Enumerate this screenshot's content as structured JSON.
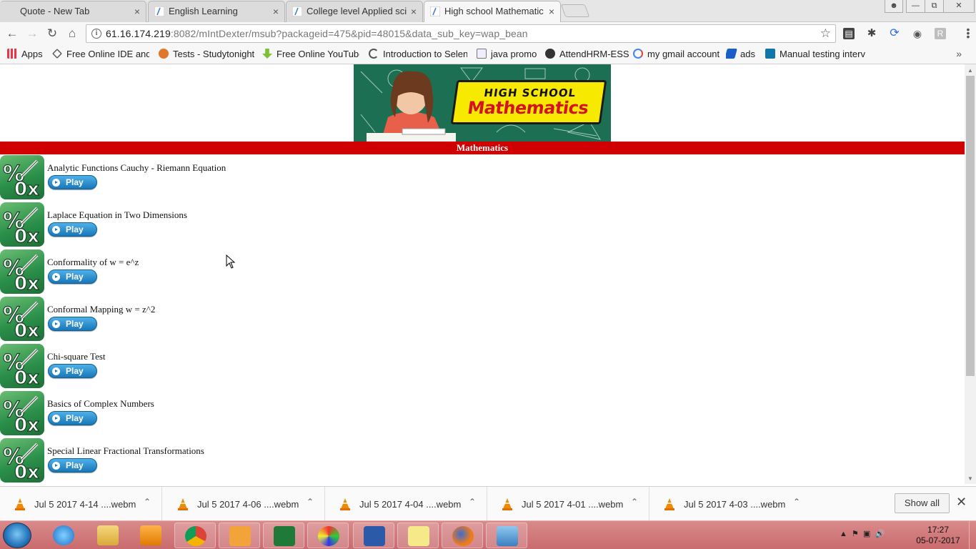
{
  "browser": {
    "tabs": [
      {
        "label": "Quote - New Tab",
        "active": false
      },
      {
        "label": "English Learning",
        "active": false
      },
      {
        "label": "College level Applied sci",
        "active": false
      },
      {
        "label": "High school Mathematic",
        "active": true
      }
    ],
    "close_glyph": "×",
    "url_host": "61.16.174.219",
    "url_rest": ":8082/mIntDexter/msub?packageid=475&pid=48015&data_sub_key=wap_bean",
    "bookmarks": [
      {
        "label": "Apps",
        "icon": "apps-grid-icon"
      },
      {
        "label": "Free Online IDE and T",
        "icon": "ide-icon"
      },
      {
        "label": "Tests - Studytonight",
        "icon": "studytonight-icon"
      },
      {
        "label": "Free Online YouTube",
        "icon": "download-arrow-icon"
      },
      {
        "label": "Introduction to Selen",
        "icon": "selenium-icon"
      },
      {
        "label": "java promo",
        "icon": "page-icon"
      },
      {
        "label": "AttendHRM-ESS",
        "icon": "gear-icon"
      },
      {
        "label": "my gmail account",
        "icon": "google-icon"
      },
      {
        "label": "ads",
        "icon": "ads-icon"
      },
      {
        "label": "Manual testing interv",
        "icon": "linkedin-icon"
      }
    ],
    "profile_initial": "R"
  },
  "page": {
    "banner": {
      "line1": "HIGH SCHOOL",
      "line2": "Mathematics"
    },
    "section_title": "Mathematics",
    "play_label": "Play",
    "items": [
      {
        "title": "Analytic Functions Cauchy - Riemann Equation"
      },
      {
        "title": "Laplace Equation in Two Dimensions"
      },
      {
        "title": "Conformality of w = e^z"
      },
      {
        "title": "Conformal Mapping w = z^2"
      },
      {
        "title": "Chi-square Test"
      },
      {
        "title": "Basics of Complex Numbers"
      },
      {
        "title": "Special Linear Fractional Transformations"
      }
    ]
  },
  "downloads": {
    "files": [
      {
        "name": "Jul 5 2017 4-14 ....webm"
      },
      {
        "name": "Jul 5 2017 4-06 ....webm"
      },
      {
        "name": "Jul 5 2017 4-04 ....webm"
      },
      {
        "name": "Jul 5 2017 4-01 ....webm"
      },
      {
        "name": "Jul 5 2017 4-03 ....webm"
      }
    ],
    "show_all": "Show all"
  },
  "taskbar": {
    "time": "17:27",
    "date": "05-07-2017"
  },
  "colors": {
    "section_bar": "#d10000",
    "play_button": "#1877b8",
    "taskbar": "#c96b6f"
  }
}
